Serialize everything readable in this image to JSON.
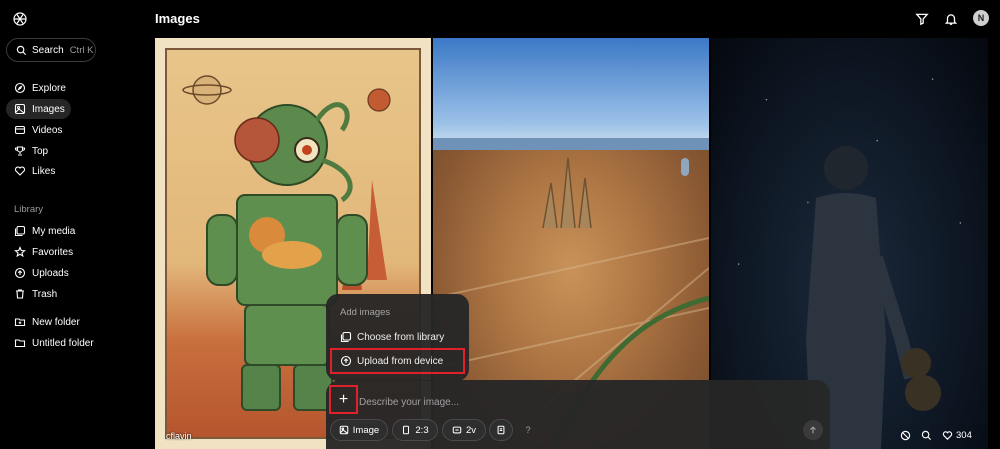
{
  "sidebar": {
    "search_label": "Search",
    "search_shortcut": "Ctrl K",
    "nav": [
      {
        "label": "Explore",
        "icon": "compass-icon"
      },
      {
        "label": "Images",
        "icon": "image-icon"
      },
      {
        "label": "Videos",
        "icon": "video-icon"
      },
      {
        "label": "Top",
        "icon": "trophy-icon"
      },
      {
        "label": "Likes",
        "icon": "heart-icon"
      }
    ],
    "library_label": "Library",
    "library": [
      {
        "label": "My media",
        "icon": "media-icon"
      },
      {
        "label": "Favorites",
        "icon": "star-icon"
      },
      {
        "label": "Uploads",
        "icon": "upload-icon"
      },
      {
        "label": "Trash",
        "icon": "trash-icon"
      }
    ],
    "folders": [
      {
        "label": "New folder",
        "icon": "folder-plus-icon"
      },
      {
        "label": "Untitled folder",
        "icon": "folder-icon"
      }
    ]
  },
  "header": {
    "title": "Images",
    "avatar_initial": "N"
  },
  "gallery": {
    "tile1_author": "cflavin",
    "likes_count": "304"
  },
  "add_images_menu": {
    "title": "Add images",
    "items": [
      "Choose from library",
      "Upload from device"
    ]
  },
  "composer": {
    "plus": "+",
    "placeholder": "Describe your image...",
    "mode": "Image",
    "aspect": "2:3",
    "variants": "2v",
    "help": "?"
  },
  "colors": {
    "highlight": "#e0202a",
    "background": "#000000",
    "panel": "#262626"
  }
}
